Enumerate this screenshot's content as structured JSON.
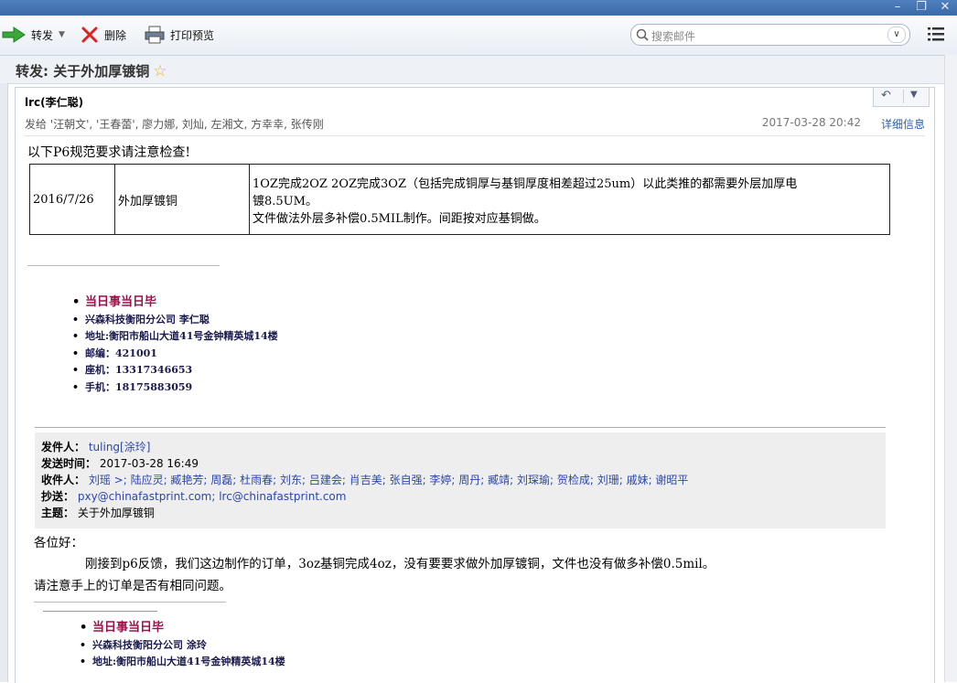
{
  "window": {
    "controls": [
      "–",
      "❐",
      "✕"
    ]
  },
  "toolbar": {
    "forward_label": "转发",
    "delete_label": "删除",
    "print_label": "打印预览",
    "search_placeholder": "搜索邮件"
  },
  "subject": {
    "title": "转发: 关于外加厚镀铜",
    "star": "☆"
  },
  "message": {
    "sender": "lrc(李仁聪)",
    "recipients": "发给 '汪朝文', '王春蕾', 廖力娜, 刘灿, 左湘文, 方幸幸, 张传刚",
    "date": "2017-03-28 20:42",
    "details_link": "详细信息",
    "intro": "以下P6规范要求请注意检查!",
    "spec_table": {
      "date": "2016/7/26",
      "item": "外加厚镀铜",
      "desc_line1": "1OZ完成2OZ  2OZ完成3OZ（包括完成铜厚与基铜厚度相差超过25um）以此类推的都需要外层加厚电",
      "desc_line2": "镀8.5UM。",
      "desc_line3": "文件做法外层多补偿0.5MIL制作。间距按对应基铜做。"
    },
    "signature": [
      "当日事当日毕",
      "兴森科技衡阳分公司   李仁聪",
      "地址:衡阳市船山大道41号金钟精英城14楼",
      "邮编：421001",
      "座机：13317346653",
      "手机：18175883059"
    ]
  },
  "quoted": {
    "from_label": "发件人：",
    "from_value": "tuling[涂玲]",
    "sent_label": "发送时间：",
    "sent_value": "2017-03-28 16:49",
    "to_label": "收件人：",
    "to_value": "刘瑶 >; 陆应灵; 臧艳芳; 周磊; 杜雨春; 刘东; 吕建会; 肖吉美; 张自强; 李婷; 周丹; 臧靖; 刘琛瑜; 贺检成; 刘珊; 戚妹; 谢昭平",
    "cc_label": "抄送：",
    "cc_value": "pxy@chinafastprint.com; lrc@chinafastprint.com",
    "subject_label": "主题：",
    "subject_value": "关于外加厚镀铜",
    "greeting": "各位好：",
    "body_line1": "刚接到p6反馈，我们这边制作的订单，3oz基铜完成4oz，没有要要求做外加厚镀铜，文件也没有做多补偿0.5mil。",
    "body_line2": "请注意手上的订单是否有相同问题。",
    "signature": [
      "当日事当日毕",
      "兴森科技衡阳分公司    涂玲",
      "地址:衡阳市船山大道41号金钟精英城14楼"
    ]
  }
}
